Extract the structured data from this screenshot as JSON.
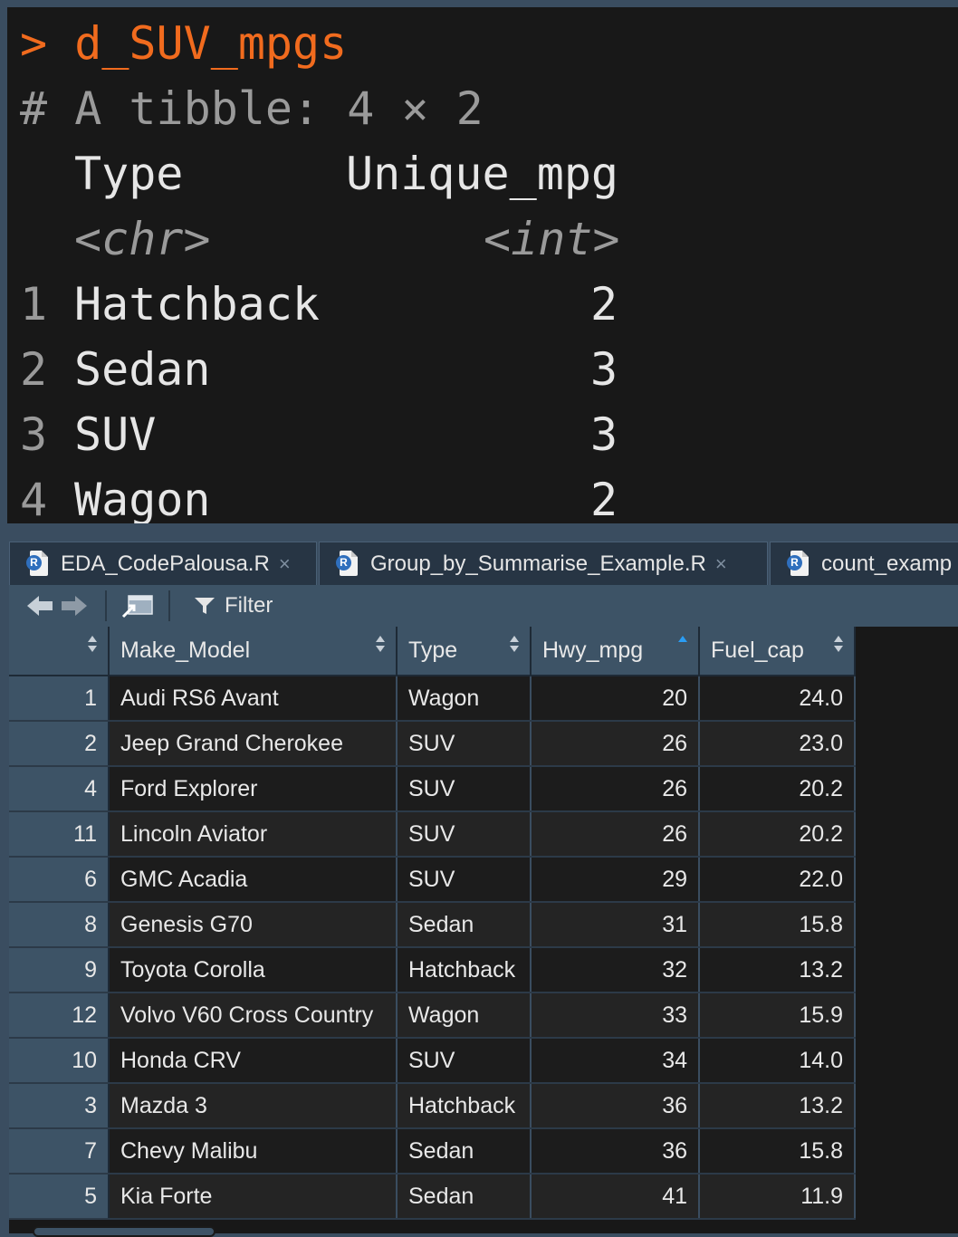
{
  "console": {
    "prompt": ">",
    "command": "d_SUV_mpgs",
    "tibble_header": "# A tibble: 4 × 2",
    "col_headers": [
      "Type",
      "Unique_mpg"
    ],
    "col_types": [
      "<chr>",
      "<int>"
    ],
    "rows": [
      {
        "idx": "1",
        "type": "Hatchback",
        "value": "2"
      },
      {
        "idx": "2",
        "type": "Sedan",
        "value": "3"
      },
      {
        "idx": "3",
        "type": "SUV",
        "value": "3"
      },
      {
        "idx": "4",
        "type": "Wagon",
        "value": "2"
      }
    ]
  },
  "tabs": [
    {
      "label": "EDA_CodePalousa.R",
      "close": "×"
    },
    {
      "label": "Group_by_Summarise_Example.R",
      "close": "×"
    },
    {
      "label": "count_examp",
      "close": ""
    }
  ],
  "toolbar": {
    "filter_label": "Filter"
  },
  "grid": {
    "columns": [
      "Make_Model",
      "Type",
      "Hwy_mpg",
      "Fuel_cap"
    ],
    "sorted_column": "Hwy_mpg",
    "rows": [
      {
        "id": "1",
        "make_model": "Audi RS6 Avant",
        "type": "Wagon",
        "hwy_mpg": "20",
        "fuel_cap": "24.0"
      },
      {
        "id": "2",
        "make_model": "Jeep Grand Cherokee",
        "type": "SUV",
        "hwy_mpg": "26",
        "fuel_cap": "23.0"
      },
      {
        "id": "4",
        "make_model": "Ford Explorer",
        "type": "SUV",
        "hwy_mpg": "26",
        "fuel_cap": "20.2"
      },
      {
        "id": "11",
        "make_model": "Lincoln Aviator",
        "type": "SUV",
        "hwy_mpg": "26",
        "fuel_cap": "20.2"
      },
      {
        "id": "6",
        "make_model": "GMC Acadia",
        "type": "SUV",
        "hwy_mpg": "29",
        "fuel_cap": "22.0"
      },
      {
        "id": "8",
        "make_model": "Genesis G70",
        "type": "Sedan",
        "hwy_mpg": "31",
        "fuel_cap": "15.8"
      },
      {
        "id": "9",
        "make_model": "Toyota Corolla",
        "type": "Hatchback",
        "hwy_mpg": "32",
        "fuel_cap": "13.2"
      },
      {
        "id": "12",
        "make_model": "Volvo V60 Cross Country",
        "type": "Wagon",
        "hwy_mpg": "33",
        "fuel_cap": "15.9"
      },
      {
        "id": "10",
        "make_model": "Honda CRV",
        "type": "SUV",
        "hwy_mpg": "34",
        "fuel_cap": "14.0"
      },
      {
        "id": "3",
        "make_model": "Mazda 3",
        "type": "Hatchback",
        "hwy_mpg": "36",
        "fuel_cap": "13.2"
      },
      {
        "id": "7",
        "make_model": "Chevy Malibu",
        "type": "Sedan",
        "hwy_mpg": "36",
        "fuel_cap": "15.8"
      },
      {
        "id": "5",
        "make_model": "Kia Forte",
        "type": "Sedan",
        "hwy_mpg": "41",
        "fuel_cap": "11.9"
      }
    ]
  },
  "colors": {
    "command": "#f16b1e",
    "sort_active": "#2a9df4",
    "header_bg": "#3d5366",
    "console_bg": "#181818"
  }
}
